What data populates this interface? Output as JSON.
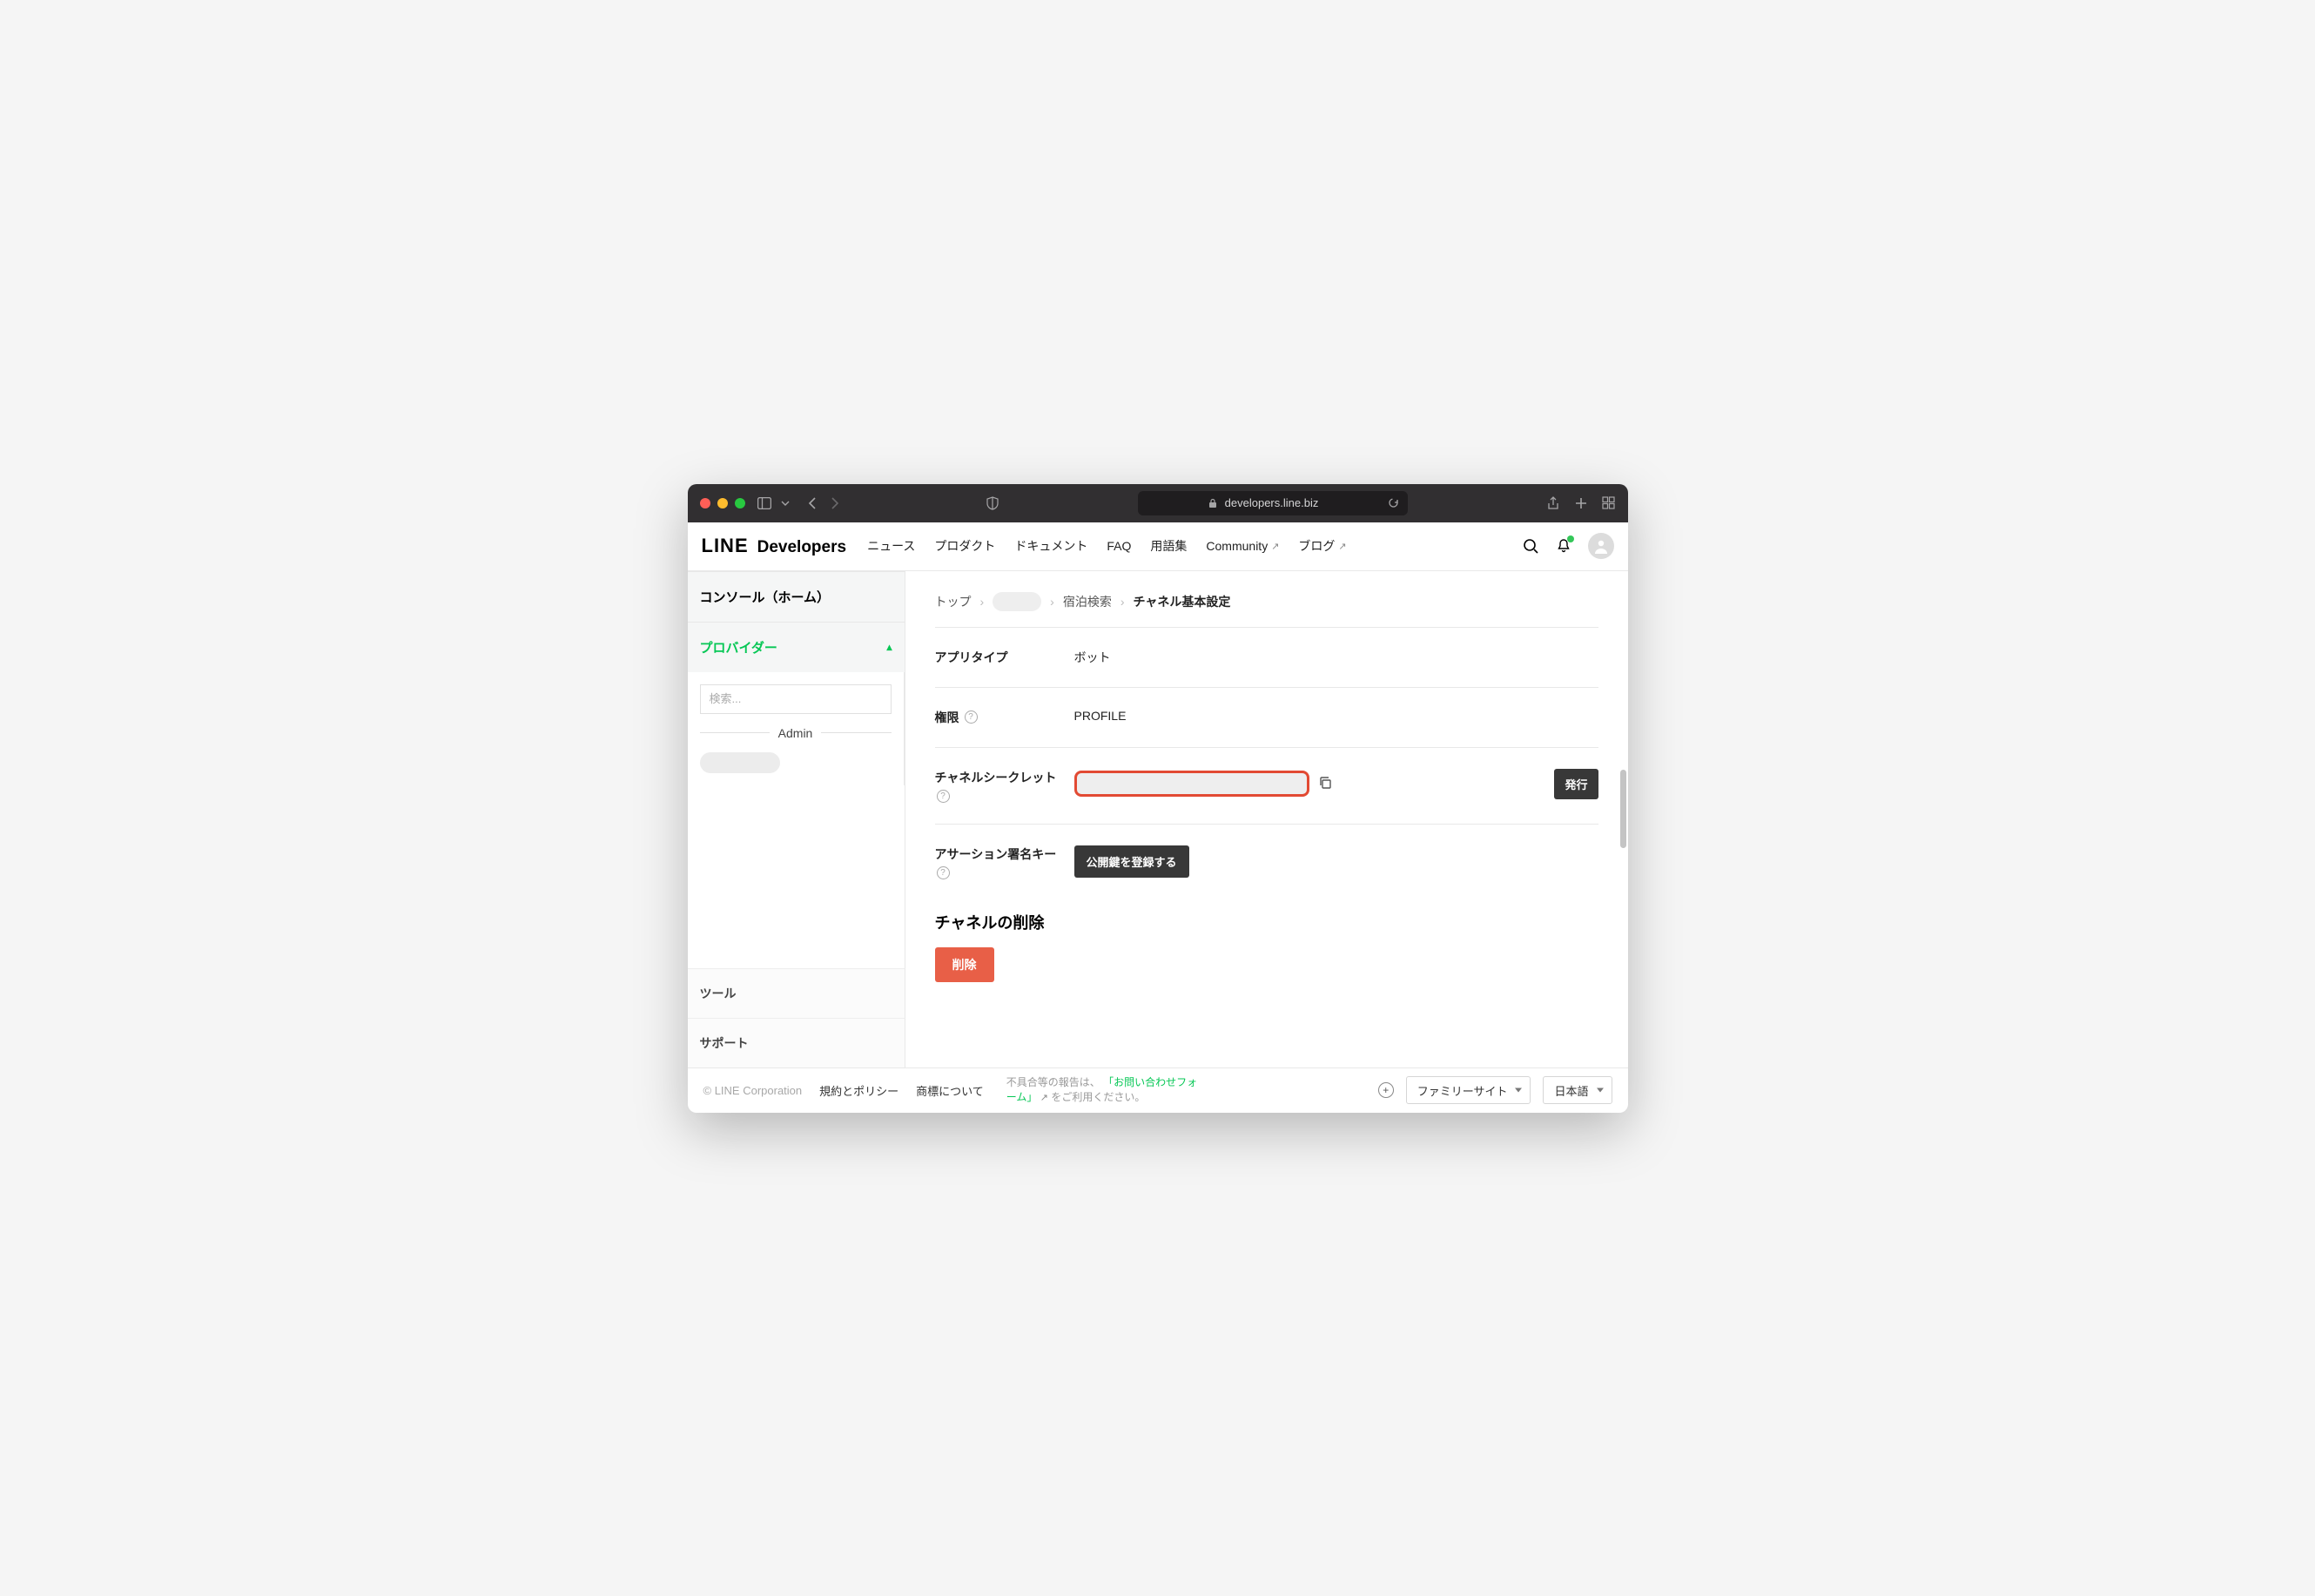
{
  "browser": {
    "url_host": "developers.line.biz"
  },
  "brand": {
    "line": "LINE",
    "dev": "Developers"
  },
  "nav": {
    "news": "ニュース",
    "products": "プロダクト",
    "docs": "ドキュメント",
    "faq": "FAQ",
    "glossary": "用語集",
    "community": "Community",
    "blog": "ブログ"
  },
  "sidebar": {
    "console_home": "コンソール（ホーム）",
    "provider": "プロバイダー",
    "search_placeholder": "検索...",
    "admin_label": "Admin",
    "tools": "ツール",
    "support": "サポート"
  },
  "breadcrumbs": {
    "top": "トップ",
    "channel": "宿泊検索",
    "current": "チャネル基本設定"
  },
  "fields": {
    "app_type_label": "アプリタイプ",
    "app_type_value": "ボット",
    "permission_label": "権限",
    "permission_value": "PROFILE",
    "secret_label": "チャネルシークレット",
    "issue_btn": "発行",
    "assertion_label": "アサーション署名キー",
    "register_btn": "公開鍵を登録する"
  },
  "delete": {
    "title": "チャネルの削除",
    "btn": "削除"
  },
  "footer": {
    "copyright": "© LINE Corporation",
    "terms": "規約とポリシー",
    "trademark": "商標について",
    "note_pre": "不具合等の報告は、",
    "note_link": "「お問い合わせフォーム」",
    "note_post": "をご利用ください。",
    "family": "ファミリーサイト",
    "lang": "日本語"
  }
}
